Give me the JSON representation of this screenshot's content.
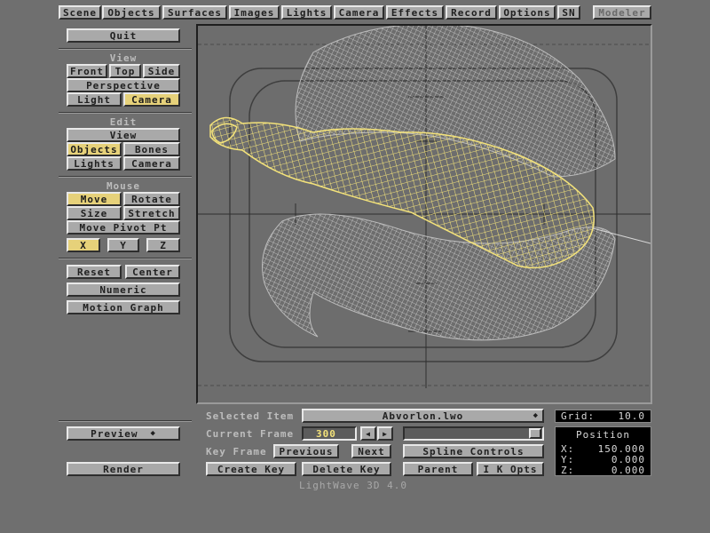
{
  "app": {
    "name": "LightWave 3D 4.0"
  },
  "top_tabs": [
    "Scene",
    "Objects",
    "Surfaces",
    "Images",
    "Lights",
    "Camera",
    "Effects",
    "Record",
    "Options",
    "SN"
  ],
  "modeler_button": "Modeler",
  "left_panel": {
    "quit": "Quit",
    "view": {
      "header": "View",
      "front": "Front",
      "top": "Top",
      "side": "Side",
      "perspective": "Perspective",
      "light": "Light",
      "camera": "Camera"
    },
    "edit": {
      "header": "Edit",
      "view": "View",
      "objects": "Objects",
      "bones": "Bones",
      "lights": "Lights",
      "camera": "Camera"
    },
    "mouse": {
      "header": "Mouse",
      "move": "Move",
      "rotate": "Rotate",
      "size": "Size",
      "stretch": "Stretch",
      "pivot": "Move Pivot Pt",
      "x": "X",
      "y": "Y",
      "z": "Z"
    },
    "reset": "Reset",
    "center": "Center",
    "numeric": "Numeric",
    "motion_graph": "Motion Graph",
    "preview": "Preview",
    "render": "Render"
  },
  "bottom": {
    "selected_item_label": "Selected Item",
    "selected_item_value": "Abvorlon.lwo",
    "current_frame_label": "Current Frame",
    "current_frame_value": "300",
    "key_frame_label": "Key Frame",
    "previous": "Previous",
    "next": "Next",
    "spline_controls": "Spline Controls",
    "create_key": "Create Key",
    "delete_key": "Delete Key",
    "parent": "Parent",
    "ik_opts": "I K Opts",
    "footer": "LightWave 3D 4.0"
  },
  "grid": {
    "label": "Grid:",
    "value": "10.0"
  },
  "position": {
    "title": "Position",
    "x_label": "X:",
    "x": "150.000",
    "y_label": "Y:",
    "y": "0.000",
    "z_label": "Z:",
    "z": "0.000"
  },
  "colors": {
    "active": "#e6d17a",
    "wireframe_selected": "#f2e27a",
    "wireframe_other": "#c8c8c8",
    "background": "#6f6f6f"
  },
  "icons": {
    "dropdown": "updown-arrows-icon",
    "frame_prev": "left-arrow-icon",
    "frame_next": "right-arrow-icon"
  }
}
